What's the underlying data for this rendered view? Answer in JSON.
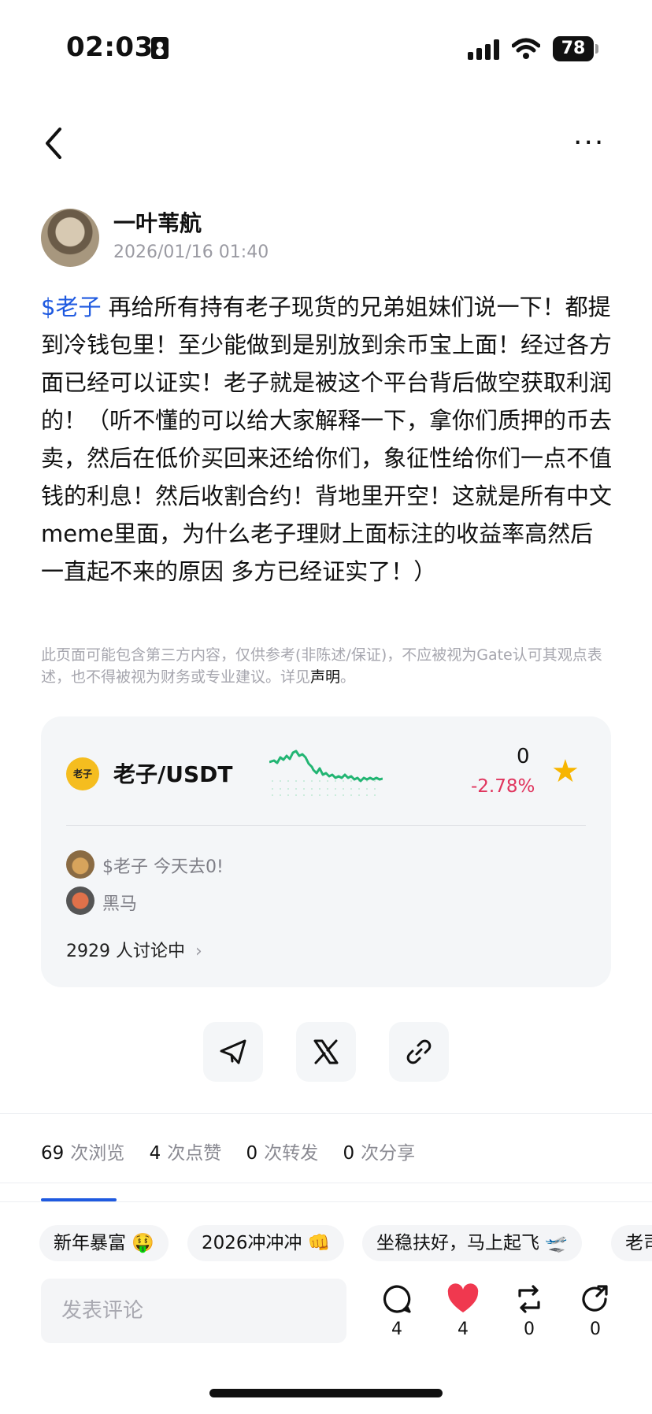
{
  "status_bar": {
    "time": "02:03",
    "battery": "78"
  },
  "post": {
    "author": "一叶苇航",
    "timestamp": "2026/01/16 01:40",
    "tag": "$老子",
    "body": " 再给所有持有老子现货的兄弟姐妹们说一下！都提到冷钱包里！至少能做到是别放到余币宝上面！经过各方面已经可以证实！老子就是被这个平台背后做空获取利润的！（听不懂的可以给大家解释一下，拿你们质押的币去卖，然后在低价买回来还给你们，象征性给你们一点不值钱的利息！然后收割合约！背地里开空！这就是所有中文meme里面，为什么老子理财上面标注的收益率高然后一直起不来的原因 多方已经证实了！）",
    "disclaimer": "此页面可能包含第三方内容，仅供参考(非陈述/保证)，不应被视为Gate认可其观点表述，也不得被视为财务或专业建议。详见",
    "disclaimer_link": "声明",
    "disclaimer_end": "。"
  },
  "token_card": {
    "logo_text": "老子",
    "pair": "老子/USDT",
    "price": "0",
    "change": "-2.78%",
    "topics": [
      "$老子 今天去0!",
      "黑马"
    ],
    "discussion": "2929 人讨论中"
  },
  "share": {
    "icons": [
      "telegram-icon",
      "x-icon",
      "link-icon"
    ]
  },
  "stats": {
    "views": "69",
    "views_label": "次浏览",
    "likes": "4",
    "likes_label": "次点赞",
    "reposts": "0",
    "reposts_label": "次转发",
    "shares": "0",
    "shares_label": "次分享"
  },
  "chips": [
    "新年暴富 🤑",
    "2026冲冲冲 👊",
    "坐稳扶好，马上起飞 🛫",
    "老司"
  ],
  "comment": {
    "placeholder": "发表评论"
  },
  "actions": {
    "comments": "4",
    "likes": "4",
    "reposts": "0",
    "shares": "0"
  },
  "colors": {
    "accent": "#1f5ae0",
    "negative": "#e0345d",
    "chart": "#22b573",
    "star": "#f7b500",
    "heart": "#f0384f"
  }
}
